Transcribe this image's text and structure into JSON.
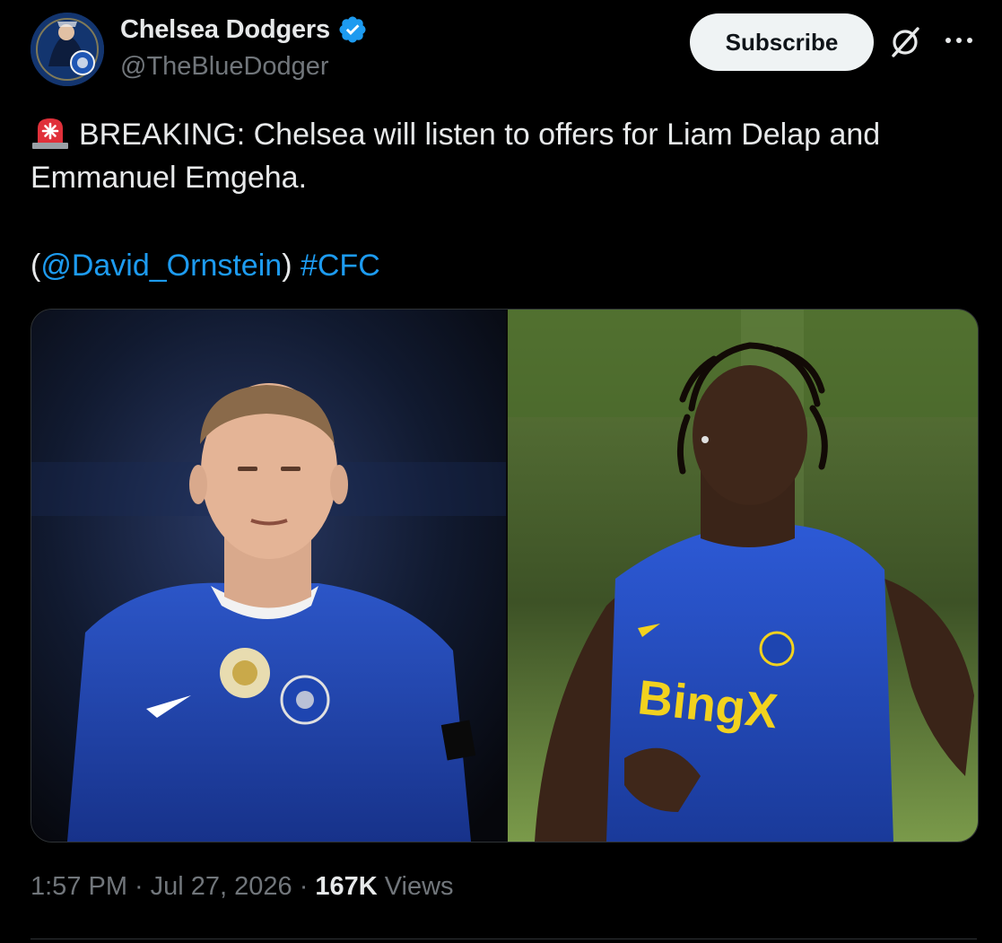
{
  "author": {
    "display_name": "Chelsea Dodgers",
    "handle": "@TheBlueDodger",
    "verified": true,
    "avatar_icon": "chelsea-crest-avatar"
  },
  "actions": {
    "subscribe_label": "Subscribe",
    "grok_icon": "grok-icon",
    "more_icon": "more-icon"
  },
  "tweet": {
    "siren_icon": "rotating-light-emoji",
    "line1": "BREAKING: Chelsea will listen to offers for Liam Delap and",
    "line2": "Emmanuel Emgeha.",
    "paren_open": "(",
    "mention": "@David_Ornstein",
    "paren_close": ")",
    "hashtag": "#CFC"
  },
  "media": {
    "left_photo": "Chelsea player in blue home kit",
    "right_photo": "Chelsea player in blue training vest with BingX sponsor"
  },
  "meta": {
    "time": "1:57 PM",
    "separator": "·",
    "date": "Jul 27, 2026",
    "views_count": "167K",
    "views_label": "Views"
  },
  "colors": {
    "background": "#000000",
    "text": "#e7e9ea",
    "muted": "#71767b",
    "link": "#1d9bf0",
    "verified": "#1d9bf0",
    "button_bg": "#eff3f4"
  }
}
